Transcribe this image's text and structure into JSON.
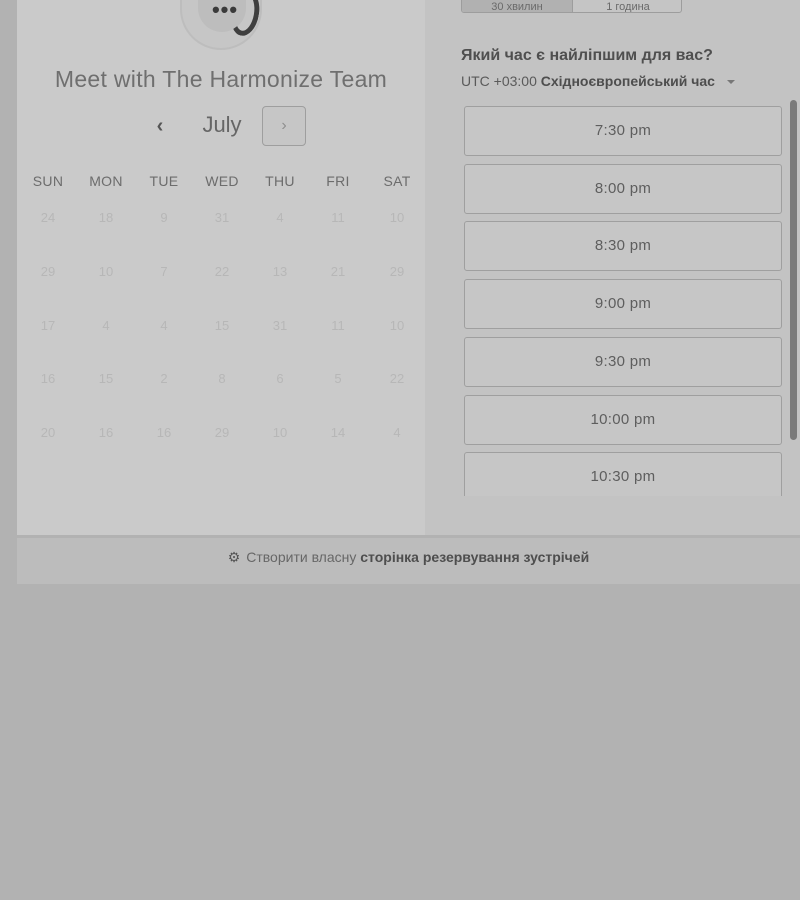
{
  "header": {
    "avatar_dots": "•••",
    "title": "Meet with The Harmonize Team"
  },
  "duration_tabs": [
    "30 хвилин",
    "1 година"
  ],
  "calendar": {
    "month": "July",
    "prev_icon": "‹",
    "next_icon": "›",
    "weekdays": [
      "SUN",
      "MON",
      "TUE",
      "WED",
      "THU",
      "FRI",
      "SAT"
    ],
    "weeks": [
      [
        "24",
        "18",
        "9",
        "31",
        "4",
        "11",
        "10"
      ],
      [
        "29",
        "10",
        "7",
        "22",
        "13",
        "21",
        "29"
      ],
      [
        "17",
        "4",
        "4",
        "15",
        "31",
        "11",
        "10"
      ],
      [
        "16",
        "15",
        "2",
        "8",
        "6",
        "5",
        "22"
      ],
      [
        "20",
        "16",
        "16",
        "29",
        "10",
        "14",
        "4"
      ]
    ]
  },
  "schedule": {
    "question": "Який час є найліпшим для вас?",
    "timezone_offset": "UTC +03:00",
    "timezone_name": "Східноєвропейський час",
    "slots": [
      "7:30 pm",
      "8:00 pm",
      "8:30 pm",
      "9:00 pm",
      "9:30 pm",
      "10:00 pm",
      "10:30 pm"
    ]
  },
  "footer": {
    "icon": "sprocket-icon",
    "prefix": "Створити власну",
    "link": "сторінка резервування зустрічей"
  }
}
